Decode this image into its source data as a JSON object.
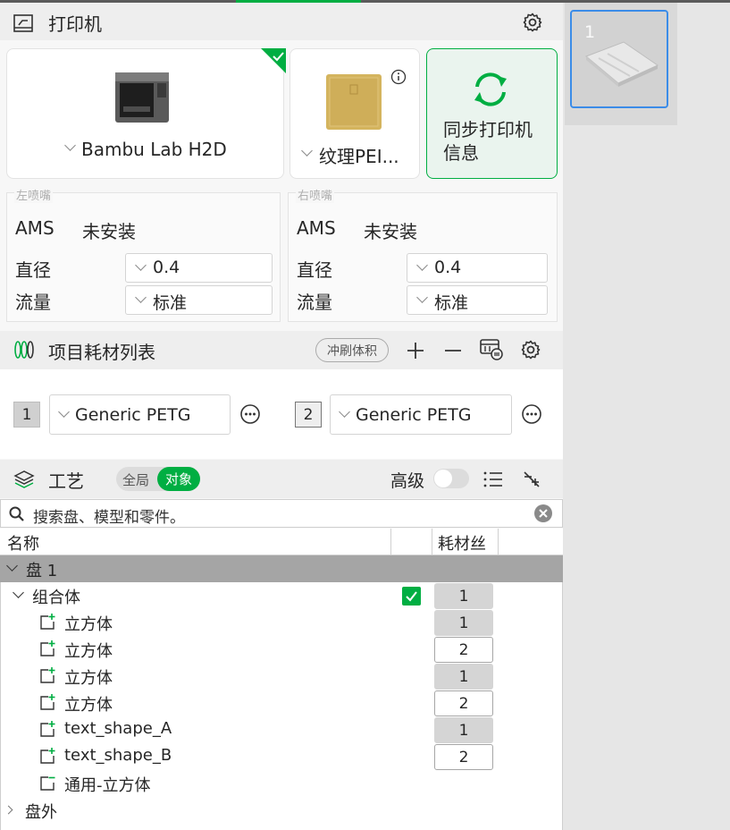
{
  "printer_section": {
    "title": "打印机",
    "printer_name": "Bambu Lab H2D",
    "plate_name": "纹理PEI...",
    "sync_button": "同步打印机信息",
    "sync_line1": "同步打印机",
    "sync_line2": "信息"
  },
  "nozzles": {
    "left": {
      "title": "左喷嘴",
      "ams_label": "AMS",
      "ams_value": "未安装",
      "diameter_label": "直径",
      "diameter_value": "0.4",
      "flow_label": "流量",
      "flow_value": "标准"
    },
    "right": {
      "title": "右喷嘴",
      "ams_label": "AMS",
      "ams_value": "未安装",
      "diameter_label": "直径",
      "diameter_value": "0.4",
      "flow_label": "流量",
      "flow_value": "标准"
    }
  },
  "filament_section": {
    "title": "项目耗材列表",
    "flush_button": "冲刷体积",
    "filaments": [
      {
        "index": "1",
        "name": "Generic PETG",
        "color": "#d0d0d0"
      },
      {
        "index": "2",
        "name": "Generic PETG",
        "color": "#eeeeee"
      }
    ]
  },
  "process_section": {
    "title": "工艺",
    "toggle_global": "全局",
    "toggle_object": "对象",
    "advanced_label": "高级",
    "search_placeholder": "搜索盘、模型和零件。"
  },
  "tree": {
    "col_name": "名称",
    "col_filament": "耗材丝",
    "plate": "盘 1",
    "assembly": "组合体",
    "assembly_filament": "1",
    "items": [
      {
        "name": "立方体",
        "filament": "1"
      },
      {
        "name": "立方体",
        "filament": "2"
      },
      {
        "name": "立方体",
        "filament": "1"
      },
      {
        "name": "立方体",
        "filament": "2"
      },
      {
        "name": "text_shape_A",
        "filament": "1"
      },
      {
        "name": "text_shape_B",
        "filament": "2"
      }
    ],
    "modifier": "通用-立方体",
    "outside": "盘外"
  },
  "thumbnail": {
    "number": "1"
  },
  "colors": {
    "accent": "#00ae42",
    "plate_row": "#a5a5a5",
    "panel_bg": "#f7f7f7"
  }
}
